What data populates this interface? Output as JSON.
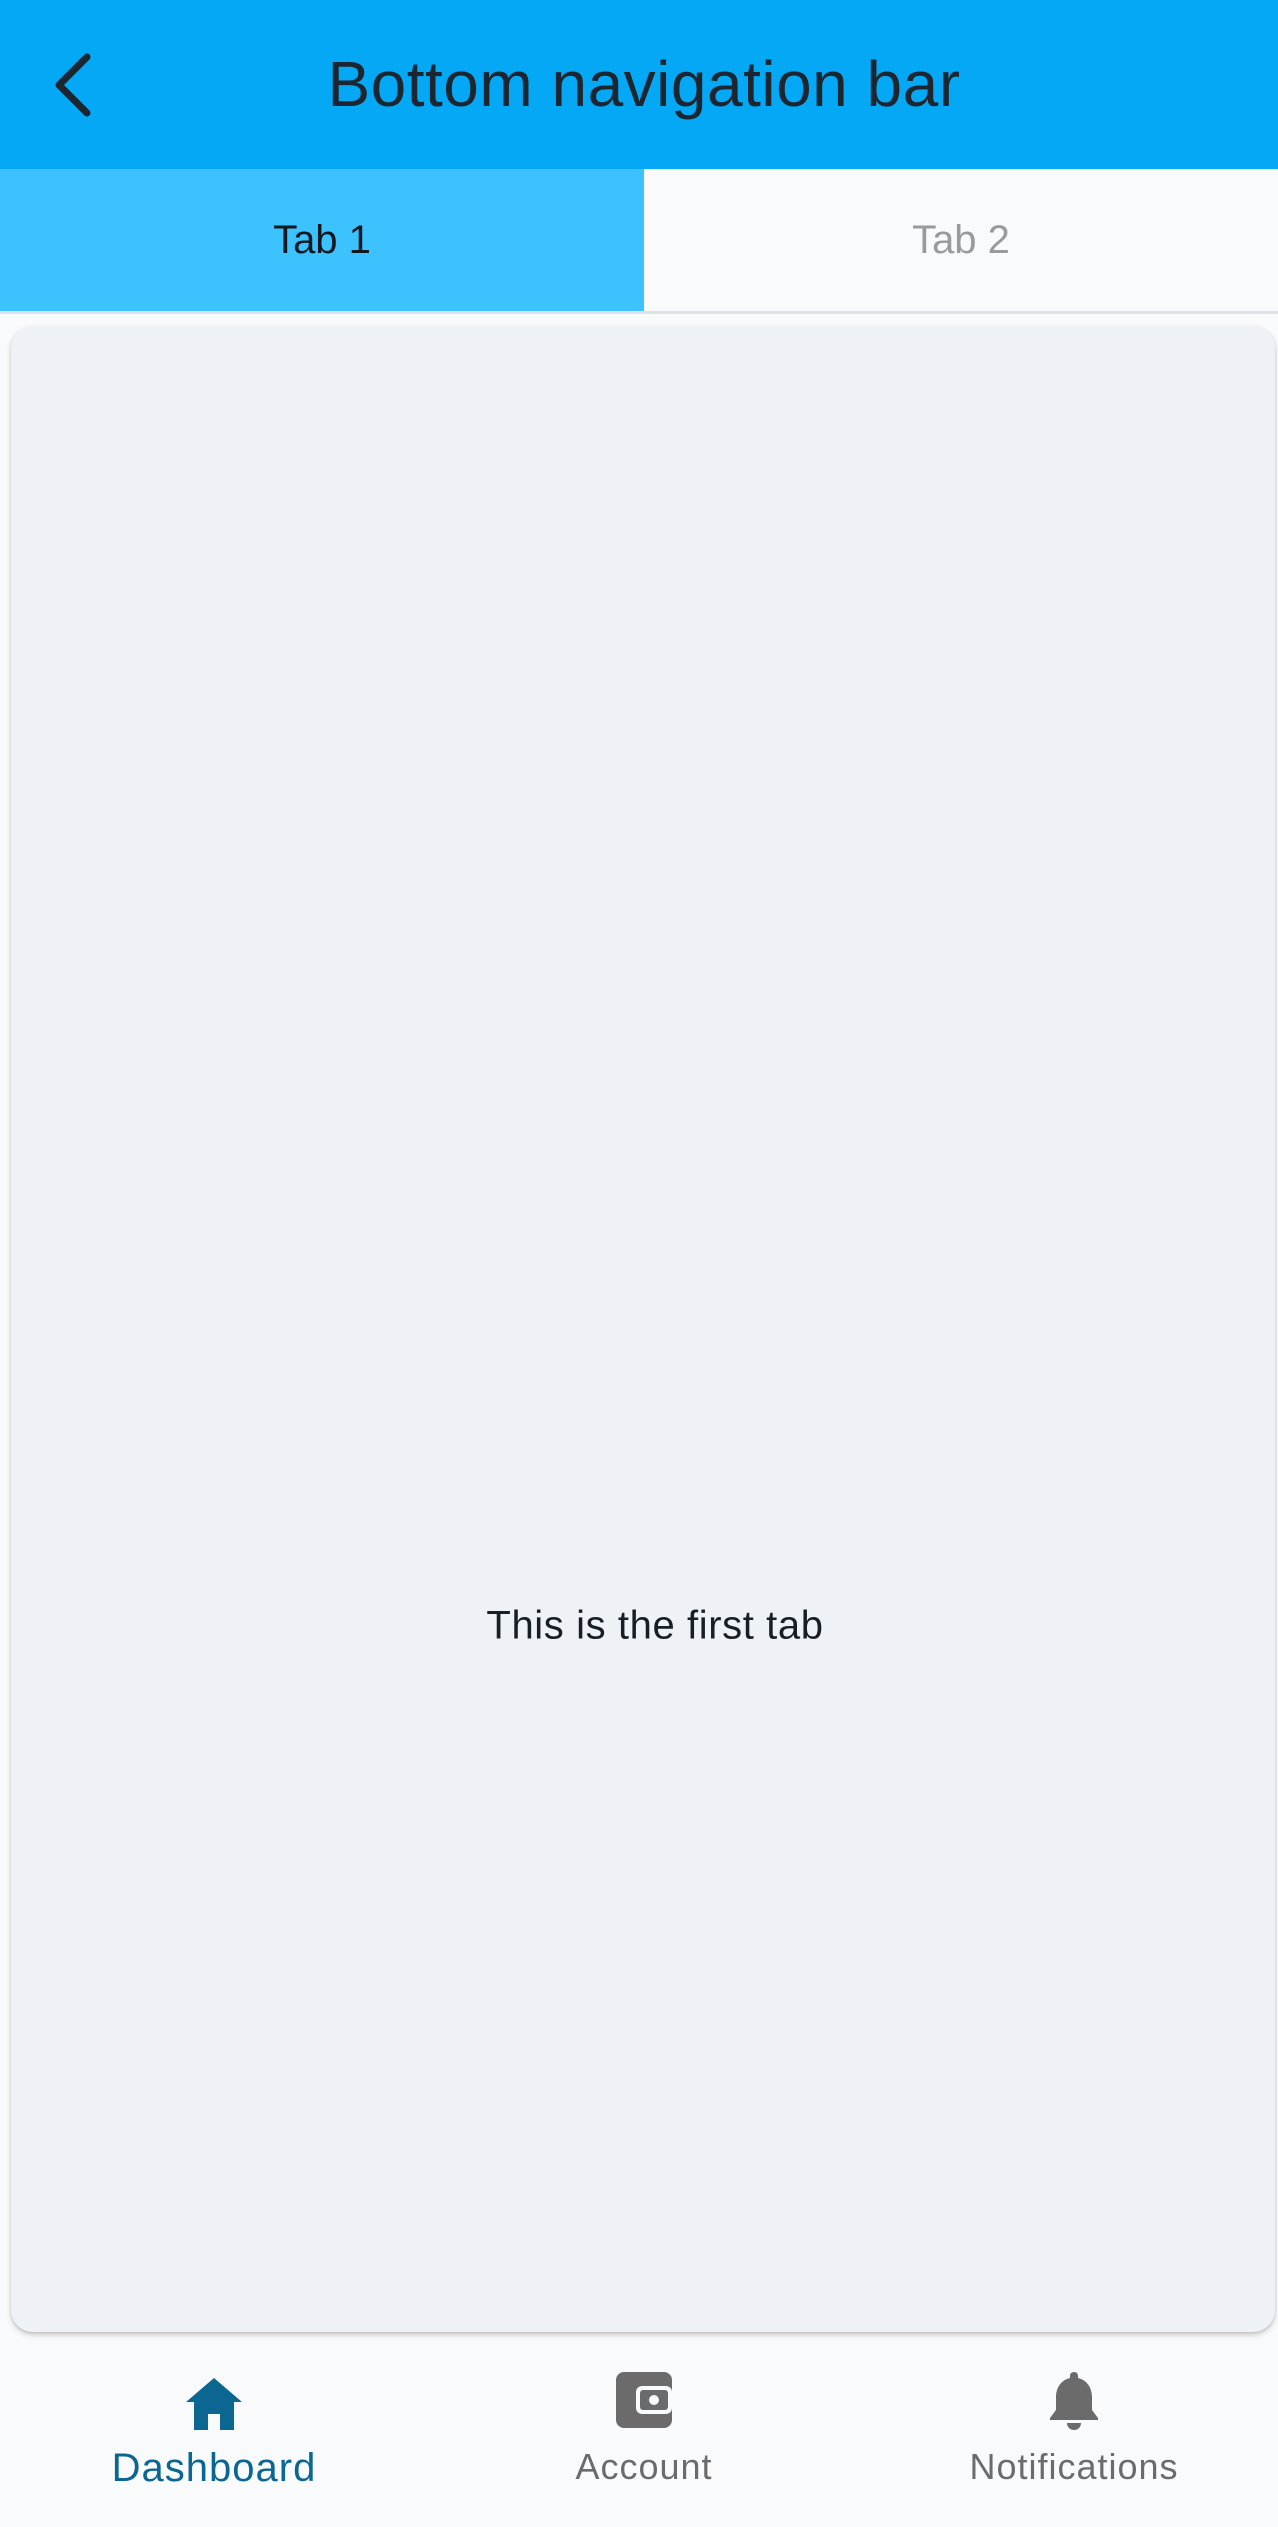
{
  "appbar": {
    "title": "Bottom navigation bar",
    "background": "#04a8f4",
    "back_icon": "chevron-left-icon"
  },
  "tabs": [
    {
      "label": "Tab 1",
      "selected": true
    },
    {
      "label": "Tab 2",
      "selected": false
    }
  ],
  "content": {
    "text": "This is the first tab"
  },
  "bottom_nav": {
    "items": [
      {
        "label": "Dashboard",
        "icon": "home-icon",
        "selected": true,
        "color": "#0b6792"
      },
      {
        "label": "Account",
        "icon": "wallet-icon",
        "selected": false,
        "color": "#6b6b6b"
      },
      {
        "label": "Notifications",
        "icon": "bell-icon",
        "selected": false,
        "color": "#6b6b6b"
      }
    ]
  }
}
